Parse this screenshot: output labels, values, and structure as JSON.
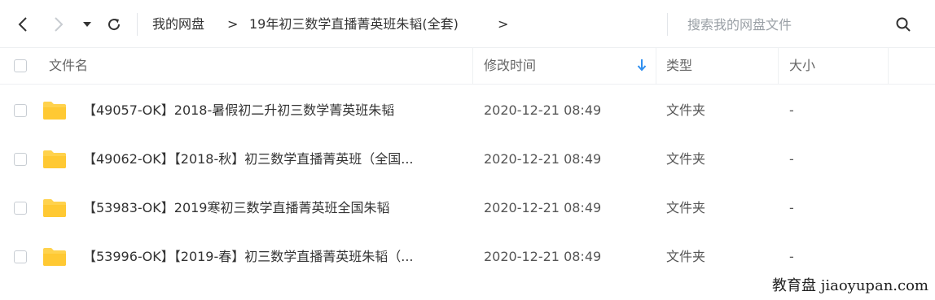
{
  "toolbar": {
    "back_icon": "chevron-left-icon",
    "forward_icon": "chevron-right-icon",
    "dropdown_icon": "caret-down-icon",
    "refresh_icon": "refresh-icon",
    "breadcrumb": [
      {
        "label": "我的网盘"
      },
      {
        "label": "19年初三数学直播菁英班朱韬(全套)"
      }
    ],
    "separator": ">",
    "search_placeholder": "搜索我的网盘文件",
    "search_icon": "search-icon"
  },
  "table": {
    "headers": {
      "name": "文件名",
      "modified": "修改时间",
      "type": "类型",
      "size": "大小"
    },
    "sort_icon": "sort-down-arrow-icon",
    "sort_color": "#2f8ff0",
    "rows": [
      {
        "name": "【49057-OK】2018-暑假初二升初三数学菁英班朱韬",
        "modified": "2020-12-21 08:49",
        "type": "文件夹",
        "size": "-"
      },
      {
        "name": "【49062-OK】【2018-秋】初三数学直播菁英班（全国...",
        "modified": "2020-12-21 08:49",
        "type": "文件夹",
        "size": "-"
      },
      {
        "name": "【53983-OK】2019寒初三数学直播菁英班全国朱韬",
        "modified": "2020-12-21 08:49",
        "type": "文件夹",
        "size": "-"
      },
      {
        "name": "【53996-OK】【2019-春】初三数学直播菁英班朱韬（...",
        "modified": "2020-12-21 08:49",
        "type": "文件夹",
        "size": "-"
      }
    ],
    "folder_color": "#ffd24d"
  },
  "watermark": "教育盘 jiaoyupan.com"
}
